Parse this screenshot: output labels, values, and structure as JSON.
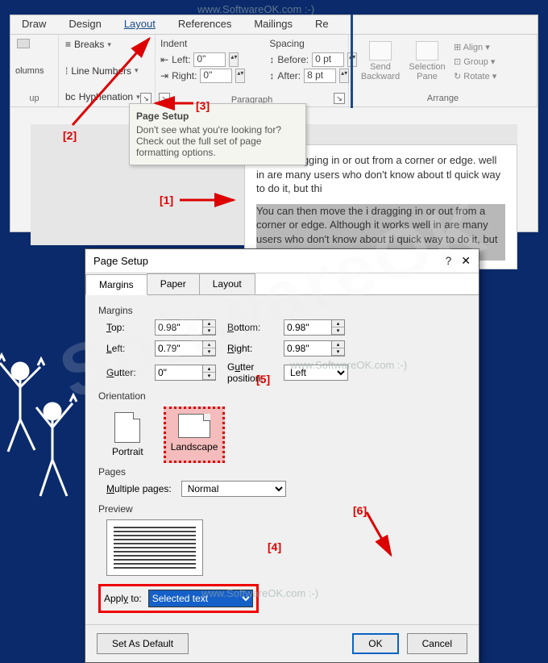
{
  "watermark": "www.SoftwareOK.com :-)",
  "wm_big": "SoftwareOK",
  "ribbon": {
    "tabs": [
      "Draw",
      "Design",
      "Layout",
      "References",
      "Mailings",
      "Re"
    ],
    "active_tab": "Layout",
    "page_setup_group": {
      "breaks": "Breaks",
      "line_numbers": "Line Numbers",
      "hyphenation": "Hyphenation",
      "columns": "olumns",
      "label": "up"
    },
    "indent": {
      "title": "Indent",
      "left_label": "Left:",
      "left_value": "0\"",
      "right_label": "Right:",
      "right_value": "0\""
    },
    "spacing": {
      "title": "Spacing",
      "before_label": "Before:",
      "before_value": "0 pt",
      "after_label": "After:",
      "after_value": "8 pt"
    },
    "paragraph_label": "Paragraph",
    "arrange": {
      "send_backward": "Send Backward",
      "selection_pane": "Selection Pane",
      "align": "Align",
      "group": "Group",
      "rotate": "Rotate",
      "label": "Arrange"
    }
  },
  "tooltip": {
    "title": "Page Setup",
    "body": "Don't see what you're looking for?\nCheck out the full set of page formatting options."
  },
  "doc": {
    "para1": "e the i dragging in or out from a corner or edge. well in  are many users who don't know about tl quick way to do it, but thi",
    "para2": "You can then move the i dragging in or out from a corner or edge. Although it works well in  are many users who don't know about tl quick way to do it, but thi"
  },
  "annotations": {
    "a1": "[1]",
    "a2": "[2]",
    "a3": "[3]",
    "a4": "[4]",
    "a5": "[5]",
    "a6": "[6]"
  },
  "dialog": {
    "title": "Page Setup",
    "tabs": [
      "Margins",
      "Paper",
      "Layout"
    ],
    "active": "Margins",
    "margins_label": "Margins",
    "top_label": "Top:",
    "top_value": "0.98\"",
    "bottom_label": "Bottom:",
    "bottom_value": "0.98\"",
    "left_label": "Left:",
    "left_value": "0.79\"",
    "right_label": "Right:",
    "right_value": "0.98\"",
    "gutter_label": "Gutter:",
    "gutter_value": "0\"",
    "gutter_pos_label": "Gutter position:",
    "gutter_pos_value": "Left",
    "orientation_label": "Orientation",
    "portrait": "Portrait",
    "landscape": "Landscape",
    "pages_label": "Pages",
    "multiple_label": "Multiple pages:",
    "multiple_value": "Normal",
    "preview_label": "Preview",
    "apply_label": "Apply to:",
    "apply_value": "Selected text",
    "set_default": "Set As Default",
    "ok": "OK",
    "cancel": "Cancel"
  }
}
